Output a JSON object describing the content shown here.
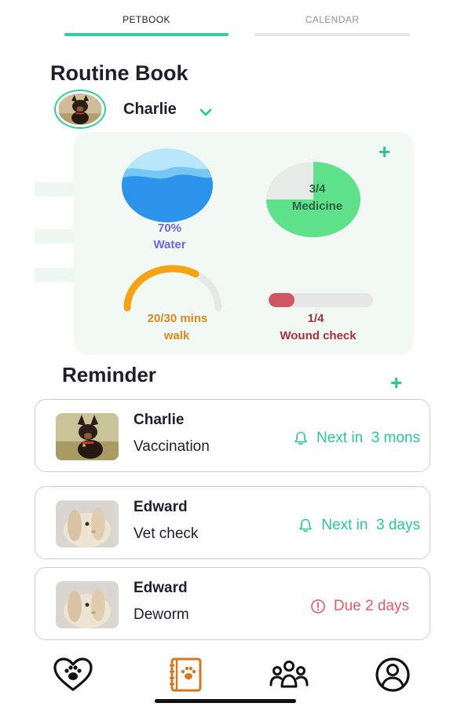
{
  "tabs": [
    {
      "label": "PETBOOK",
      "active": true
    },
    {
      "label": "CALENDAR",
      "active": false
    }
  ],
  "routine": {
    "title": "Routine Book",
    "pet_name": "Charlie",
    "water": {
      "value": "70%",
      "name": "Water",
      "fraction": 0.7
    },
    "medicine": {
      "value": "3/4",
      "name": "Medicine",
      "fraction": 0.75
    },
    "walk": {
      "value": "20/30 mins",
      "name": "walk",
      "fraction": 0.667
    },
    "wound": {
      "value": "1/4",
      "name": "Wound check",
      "fraction": 0.25
    }
  },
  "reminder": {
    "title": "Reminder",
    "items": [
      {
        "pet": "Charlie",
        "task": "Vaccination",
        "status": "Next in  3 mons",
        "kind": "upcoming",
        "icon": "bell-icon"
      },
      {
        "pet": "Edward",
        "task": "Vet check",
        "status": "Next in  3 days",
        "kind": "upcoming",
        "icon": "bell-icon"
      },
      {
        "pet": "Edward",
        "task": "Deworm",
        "status": "Due 2 days",
        "kind": "due",
        "icon": "info-icon"
      }
    ]
  },
  "nav": [
    "heart-paw-icon",
    "petbook-icon",
    "community-icon",
    "profile-icon"
  ],
  "colors": {
    "accent": "#2fd09b",
    "water": "#6b67e8",
    "walk": "#f5a312",
    "wound": "#cf5763",
    "due": "#e15a68",
    "nav_active": "#d8761c"
  }
}
